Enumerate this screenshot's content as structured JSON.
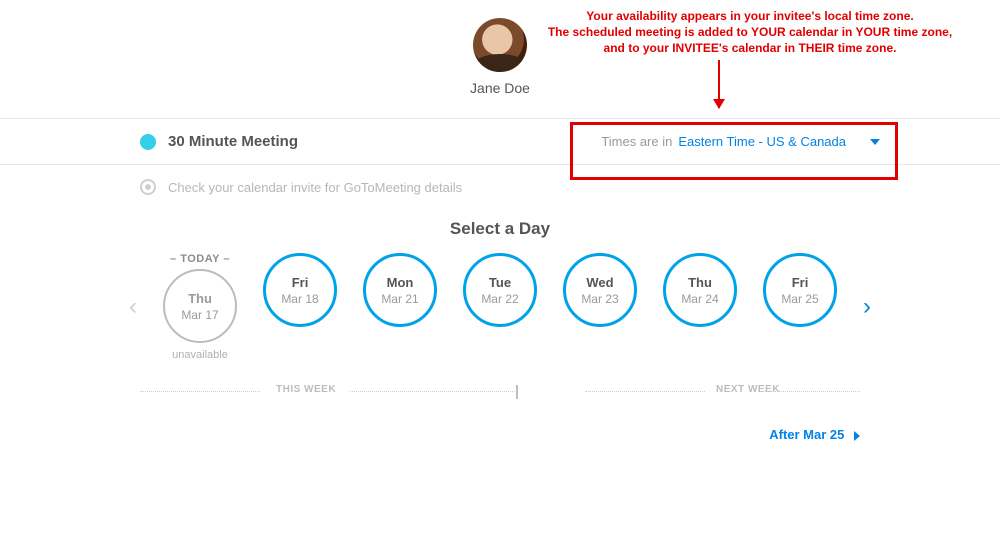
{
  "annotation": {
    "line1": "Your availability appears in your invitee's local time zone.",
    "line2": "The scheduled meeting is added to YOUR calendar in YOUR time zone,",
    "line3": "and to your INVITEE's calendar in THEIR time zone."
  },
  "host": {
    "name": "Jane Doe"
  },
  "event": {
    "title": "30 Minute Meeting"
  },
  "timezone": {
    "label": "Times are in",
    "value": "Eastern Time - US & Canada"
  },
  "meta": {
    "note": "Check your calendar invite for GoToMeeting details"
  },
  "select_title": "Select a Day",
  "week_labels": {
    "this": "THIS WEEK",
    "next": "NEXT WEEK"
  },
  "today_marker": "– TODAY –",
  "unavailable_label": "unavailable",
  "days": [
    {
      "dow": "Thu",
      "date": "Mar 17",
      "available": false,
      "is_today": true
    },
    {
      "dow": "Fri",
      "date": "Mar 18",
      "available": true,
      "is_today": false
    },
    {
      "dow": "Mon",
      "date": "Mar 21",
      "available": true,
      "is_today": false
    },
    {
      "dow": "Tue",
      "date": "Mar 22",
      "available": true,
      "is_today": false
    },
    {
      "dow": "Wed",
      "date": "Mar 23",
      "available": true,
      "is_today": false
    },
    {
      "dow": "Thu",
      "date": "Mar 24",
      "available": true,
      "is_today": false
    },
    {
      "dow": "Fri",
      "date": "Mar 25",
      "available": true,
      "is_today": false
    }
  ],
  "after_link": "After Mar 25",
  "colors": {
    "accent": "#00a2e8",
    "link": "#0083e8",
    "annotation": "#e10000"
  }
}
